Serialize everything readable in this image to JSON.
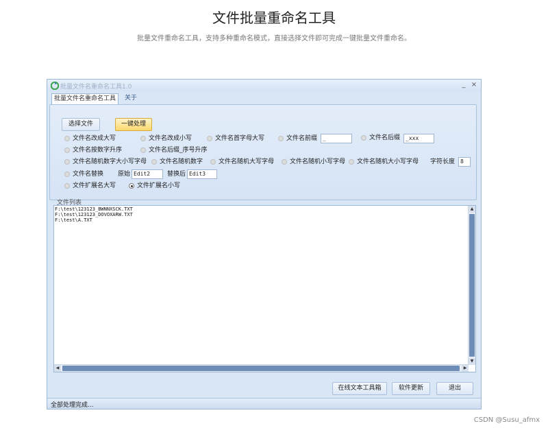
{
  "page": {
    "title": "文件批量重命名工具",
    "subtitle": "批量文件重命名工具，支持多种重命名模式，直接选择文件即可完成一键批量文件重命名。",
    "watermark": "CSDN @Susu_afmx"
  },
  "window": {
    "title": "批量文件名重命名工具1.0",
    "minimize_glyph": "_",
    "close_glyph": "×"
  },
  "tabs": [
    {
      "label": "批量文件名重命名工具",
      "active": true
    },
    {
      "label": "关于",
      "active": false
    }
  ],
  "actions": {
    "select_file": "选择文件",
    "one_click": "一键处理"
  },
  "options": {
    "upper_name": "文件名改成大写",
    "lower_name": "文件名改成小写",
    "capitalize_first": "文件名首字母大写",
    "prefix": "文件名前缀",
    "prefix_value": "_",
    "suffix": "文件名后缀",
    "suffix_value": "_xxx",
    "number_asc": "文件名按数字升序",
    "suffix_seq": "文件名后缀_序号升序",
    "random_mixed": "文件名随机数字大小写字母",
    "random_digits": "文件名随机数字",
    "random_upper": "文件名随机大写字母",
    "random_lower": "文件名随机小写字母",
    "random_letters": "文件名随机大小写字母",
    "char_length_label": "字符长度",
    "char_length_value": "8",
    "replace": "文件名替换",
    "original_label": "原始",
    "original_value": "Edit2",
    "replace_with_label": "替换后",
    "replace_with_value": "Edit3",
    "ext_upper": "文件扩展名大写",
    "ext_lower": "文件扩展名小写",
    "selected": "ext_lower"
  },
  "file_list": {
    "label": "文件列表",
    "files": [
      "F:\\test\\123123_BWNNXSCK.TXT",
      "F:\\test\\123123_DOVOXARW.TXT",
      "F:\\test\\A.TXT"
    ]
  },
  "bottom_buttons": {
    "online_toolbox": "在线文本工具箱",
    "update": "软件更新",
    "exit": "退出"
  },
  "status": {
    "text": "全部处理完成..."
  }
}
